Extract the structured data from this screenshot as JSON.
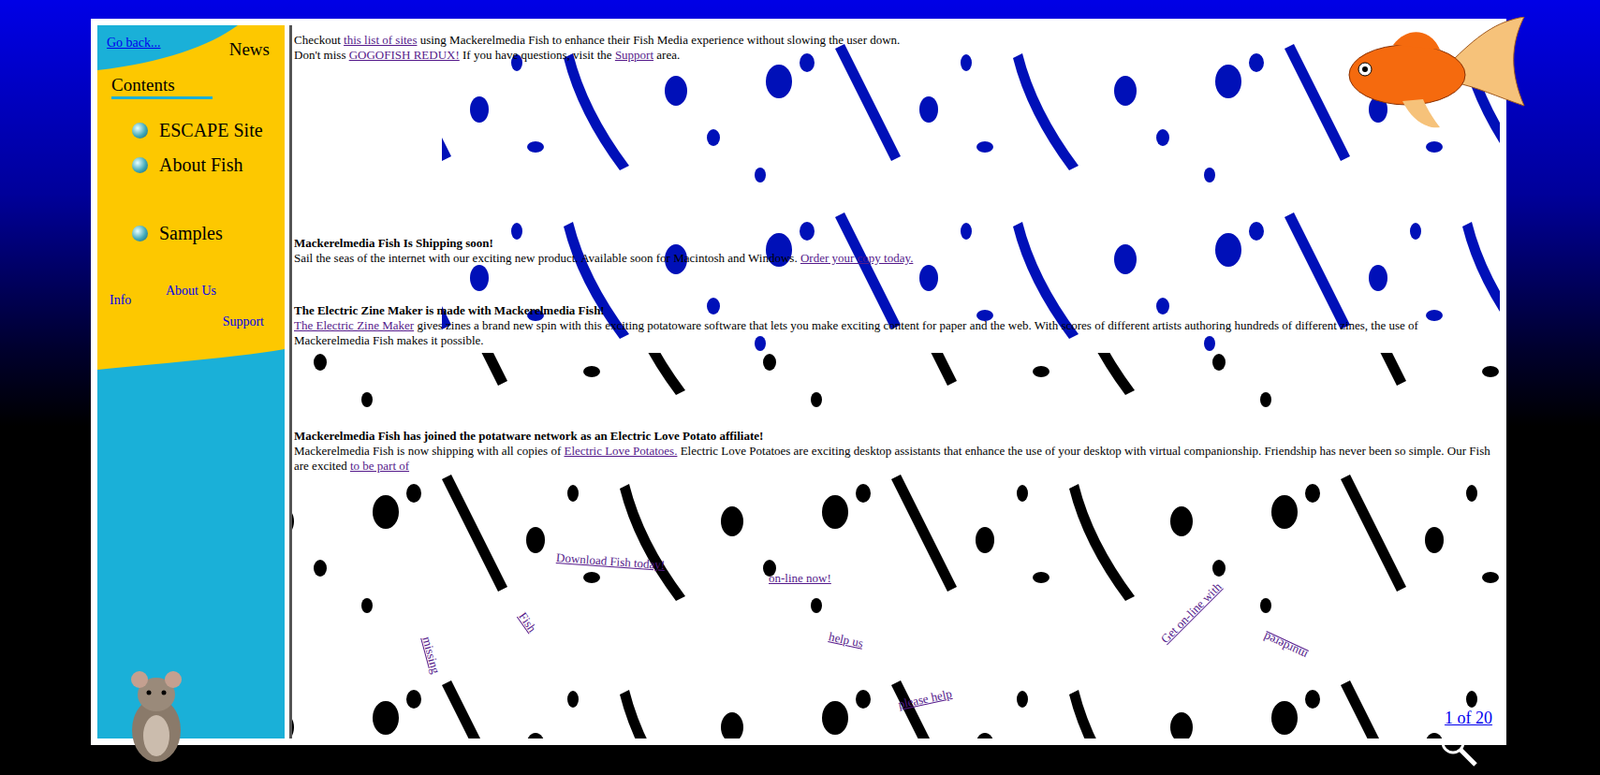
{
  "sidebar": {
    "back_link": {
      "text": "Go back...",
      "visited": false
    },
    "news_label": "News",
    "contents_heading": "Contents",
    "items": [
      {
        "label": "ESCAPE Site"
      },
      {
        "label": "About Fish"
      },
      {
        "label": "Samples"
      }
    ],
    "footer_links": [
      {
        "label": "Info"
      },
      {
        "label": "About Us"
      },
      {
        "label": "Support"
      }
    ]
  },
  "intro": [
    [
      {
        "text": "Checkout ",
        "link": false
      },
      {
        "text": "this list of sites",
        "link": true
      },
      {
        "text": " using Mackerelmedia Fish to enhance their Fish Media experience without slowing the user down.",
        "link": false
      }
    ],
    [
      {
        "text": "Don't miss ",
        "link": false
      },
      {
        "text": "GOGOFISH REDUX!",
        "link": true
      },
      {
        "text": " If you have questions, visit the ",
        "link": false
      },
      {
        "text": "Support",
        "link": true
      },
      {
        "text": " area.",
        "link": false
      }
    ]
  ],
  "news": [
    {
      "title": "Mackerelmedia Fish Is Shipping soon!",
      "body": [
        {
          "text": "Sail the seas of the internet with our exciting new product. Available soon for Macintosh and Windows. ",
          "link": false
        },
        {
          "text": "Order your copy today.",
          "link": true
        }
      ]
    },
    {
      "title": "The Electric Zine Maker is made with Mackerelmedia Fish!",
      "body": [
        {
          "text": "The Electric Zine Maker",
          "link": true
        },
        {
          "text": " gives zines a brand new spin with this exciting potatoware software that lets you make exciting content for paper and the web. With scores of different artists authoring hundreds of different zines, the use of Mackerelmedia Fish makes it possible.",
          "link": false
        }
      ]
    },
    {
      "title": "Mackerelmedia Fish has joined the potatware network as an Electric Love Potato affiliate!",
      "body": [
        {
          "text": "Mackerelmedia Fish is now shipping with all copies of ",
          "link": false
        },
        {
          "text": "Electric Love Potatoes.",
          "link": true
        },
        {
          "text": " Electric Love Potatoes are exciting desktop assistants that enhance the use of your desktop with virtual companionship. Friendship has never been so simple. Our Fish are excited ",
          "link": false
        },
        {
          "text": "to be part of",
          "link": true
        }
      ]
    }
  ],
  "floating_links": [
    {
      "text": "Download Fish today!"
    },
    {
      "text": "on-line now!"
    },
    {
      "text": "Fish"
    },
    {
      "text": "missing"
    },
    {
      "text": "help us"
    },
    {
      "text": "please help"
    },
    {
      "text": "Get on-line with"
    },
    {
      "text": "murdered"
    }
  ],
  "pager": "1 of 20"
}
